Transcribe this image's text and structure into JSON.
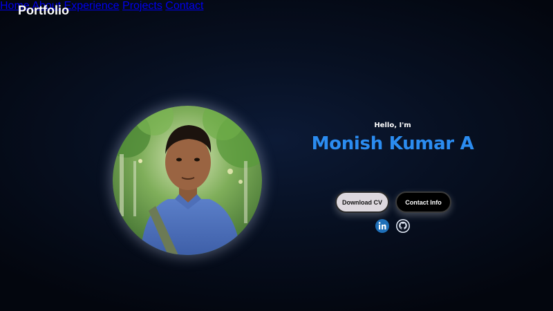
{
  "header": {
    "logo": "Portfolio",
    "nav": [
      {
        "label": "Home"
      },
      {
        "label": "About"
      },
      {
        "label": "Experience"
      },
      {
        "label": "Projects"
      },
      {
        "label": "Contact"
      }
    ]
  },
  "hero": {
    "greeting": "Hello, I'm",
    "name": "Monish Kumar A",
    "buttons": {
      "download_cv": "Download CV",
      "contact_info": "Contact Info"
    },
    "social": [
      "linkedin-icon",
      "github-icon"
    ]
  },
  "colors": {
    "accent": "#2b8cf0",
    "background": "#071022"
  }
}
